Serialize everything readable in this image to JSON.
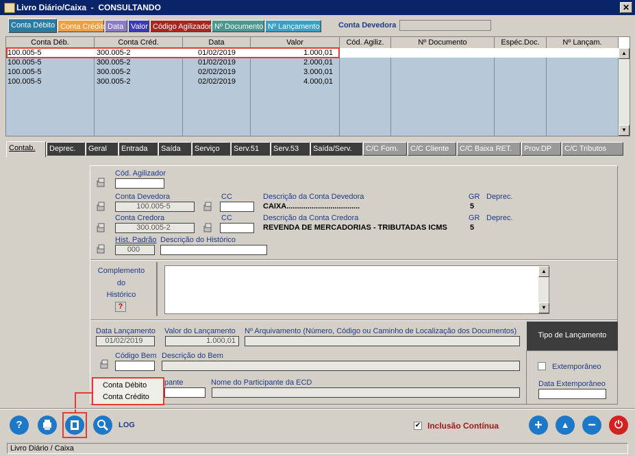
{
  "window": {
    "title": "Livro Diário/Caixa  -  CONSULTANDO",
    "close_glyph": "✕"
  },
  "top_tabs": [
    {
      "label": "Conta Débito",
      "bg": "#2a7aa8",
      "fg": "#ffffff"
    },
    {
      "label": "Conta Crédito",
      "bg": "#f0a040",
      "fg": "#ffffff"
    },
    {
      "label": "Data",
      "bg": "#8a7ac8",
      "fg": "#ffffff"
    },
    {
      "label": "Valor",
      "bg": "#3a3ab8",
      "fg": "#ffffff"
    },
    {
      "label": "Código Agilizador",
      "bg": "#a82820",
      "fg": "#ffffff"
    },
    {
      "label": "Nº Documento",
      "bg": "#4a9890",
      "fg": "#ffffff"
    },
    {
      "label": "Nº Lançamento",
      "bg": "#3aa0c8",
      "fg": "#ffffff"
    }
  ],
  "conta_devedora_label": "Conta Devedora",
  "grid": {
    "headers": [
      "Conta Déb.",
      "Conta Créd.",
      "Data",
      "Valor",
      "Cód. Agiliz.",
      "Nº Documento",
      "Espéc.Doc.",
      "Nº Lançam."
    ],
    "rows": [
      {
        "deb": "100.005-5",
        "cred": "300.005-2",
        "data": "01/02/2019",
        "valor": "1.000,01"
      },
      {
        "deb": "100.005-5",
        "cred": "300.005-2",
        "data": "01/02/2019",
        "valor": "2.000,01"
      },
      {
        "deb": "100.005-5",
        "cred": "300.005-2",
        "data": "02/02/2019",
        "valor": "3.000,01"
      },
      {
        "deb": "100.005-5",
        "cred": "300.005-2",
        "data": "02/02/2019",
        "valor": "4.000,01"
      }
    ]
  },
  "second_tabs": [
    "Contab.",
    "Deprec.",
    "Geral",
    "Entrada",
    "Saída",
    "Serviço",
    "Serv.51",
    "Serv.53",
    "Saída/Serv.",
    "C/C Forn.",
    "C/C Cliente",
    "C/C Baixa RET.",
    "Prov.DP",
    "C/C Tributos"
  ],
  "form": {
    "cod_agilizador_label": "Cód. Agilizador",
    "conta_devedora_label": "Conta Devedora",
    "conta_devedora_value": "100.005-5",
    "cc_label": "CC",
    "desc_devedora_label": "Descrição da Conta Devedora",
    "desc_devedora_value": "CAIXA...................................",
    "gr_label": "GR",
    "gr_devedora": "5",
    "deprec_label": "Deprec.",
    "conta_credora_label": "Conta Credora",
    "conta_credora_value": "300.005-2",
    "desc_credora_label": "Descrição da Conta Credora",
    "desc_credora_value": "REVENDA DE MERCADORIAS - TRIBUTADAS ICMS",
    "gr_credora": "5",
    "hist_padrao_label": "Hist. Padrão",
    "hist_padrao_value": "000",
    "desc_historico_label": "Descrição do Histórico",
    "complemento_line1": "Complemento",
    "complemento_line2": "do",
    "complemento_line3": "Histórico",
    "help_glyph": "?",
    "data_lanc_label": "Data Lançamento",
    "data_lanc_value": "01/02/2019",
    "valor_lanc_label": "Valor do Lançamento",
    "valor_lanc_value": "1.000,01",
    "arquivamento_label": "Nº Arquivamento (Número, Código ou Caminho de Localização dos Documentos)",
    "tipo_lanc_label": "Tipo de Lançamento",
    "cod_bem_label": "Código Bem",
    "desc_bem_label": "Descrição do Bem",
    "extemporaneo_label": "Extemporâneo",
    "participante_label": "pante",
    "nome_participante_label": "Nome do Participante da ECD",
    "data_extemp_label": "Data Extemporâneo"
  },
  "popup_menu": [
    "Conta Débito",
    "Conta Crédito"
  ],
  "bottom": {
    "log_label": "LOG",
    "inclusao_label": "Inclusão Contínua",
    "inclusao_checked": "✔",
    "plus_glyph": "+",
    "up_glyph": "▲",
    "minus_glyph": "−",
    "power_glyph": "⏻",
    "help_glyph": "?",
    "status_text": "Livro Diário / Caixa"
  }
}
